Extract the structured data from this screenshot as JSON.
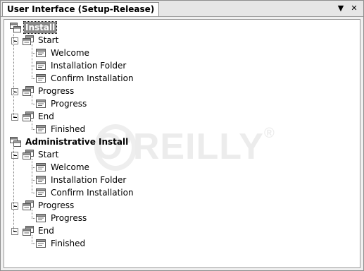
{
  "window": {
    "tab_title": "User Interface (Setup-Release)",
    "controls": {
      "dropdown_icon": "dropdown-arrow-icon",
      "close_icon": "close-icon"
    }
  },
  "watermark": {
    "text": "O'REILLY",
    "reg": "®"
  },
  "tree": {
    "install": {
      "label": "Install",
      "children": [
        {
          "label": "Start",
          "children": [
            "Welcome",
            "Installation Folder",
            "Confirm Installation"
          ]
        },
        {
          "label": "Progress",
          "children": [
            "Progress"
          ]
        },
        {
          "label": "End",
          "children": [
            "Finished"
          ]
        }
      ]
    },
    "admin": {
      "label": "Administrative Install",
      "children": [
        {
          "label": "Start",
          "children": [
            "Welcome",
            "Installation Folder",
            "Confirm Installation"
          ]
        },
        {
          "label": "Progress",
          "children": [
            "Progress"
          ]
        },
        {
          "label": "End",
          "children": [
            "Finished"
          ]
        }
      ]
    }
  },
  "colors": {
    "selected_bg": "#8a8a8a",
    "panel_bg": "#ffffff",
    "frame_bg": "#f0f0f0"
  }
}
